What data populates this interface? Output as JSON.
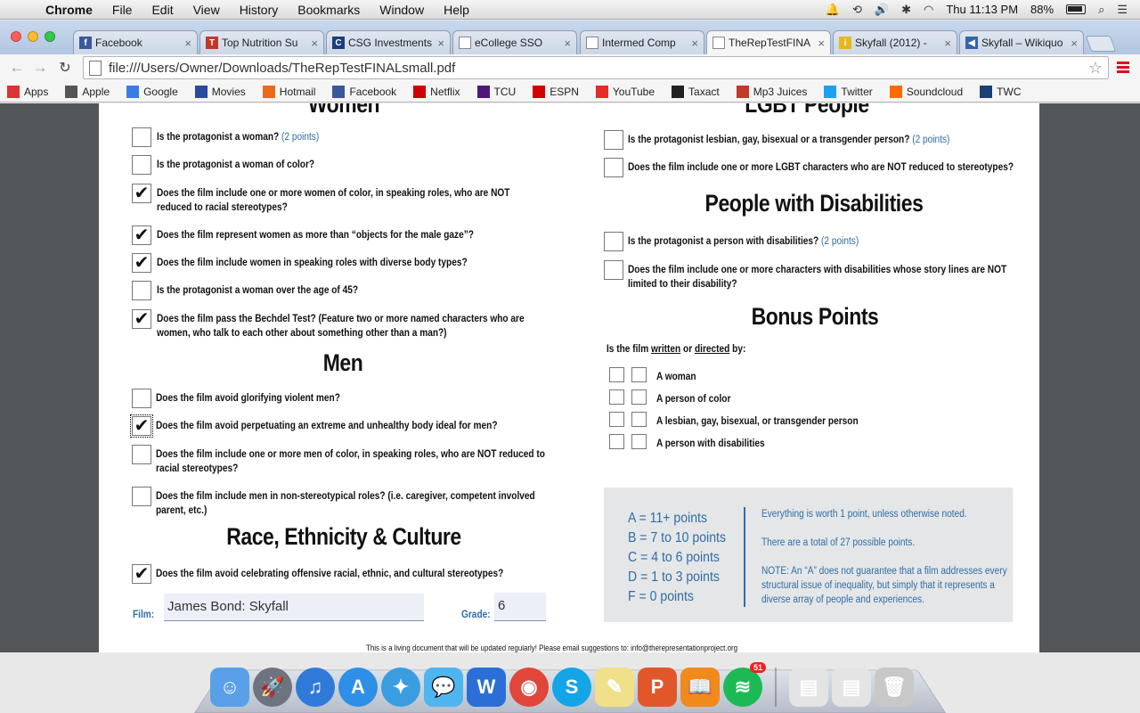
{
  "menubar": {
    "app": "Chrome",
    "items": [
      "File",
      "Edit",
      "View",
      "History",
      "Bookmarks",
      "Window",
      "Help"
    ],
    "clock": "Thu 11:13 PM",
    "battery": "88%"
  },
  "tabs": [
    {
      "label": "Facebook",
      "icon": "facebook-icon",
      "color": "#3b5998",
      "glyph": "f"
    },
    {
      "label": "Top Nutrition Su",
      "icon": "nutrition-icon",
      "color": "#c0392b",
      "glyph": "T"
    },
    {
      "label": "CSG Investments",
      "icon": "csg-icon",
      "color": "#1c3f7a",
      "glyph": "C"
    },
    {
      "label": "eCollege SSO",
      "icon": "document-icon",
      "color": "#ffffff",
      "glyph": ""
    },
    {
      "label": "Intermed Comp",
      "icon": "document-icon",
      "color": "#ffffff",
      "glyph": ""
    },
    {
      "label": "TheRepTestFINA",
      "icon": "document-icon",
      "color": "#ffffff",
      "glyph": ""
    },
    {
      "label": "Skyfall (2012) -",
      "icon": "imdb-icon",
      "color": "#e5b81d",
      "glyph": "i"
    },
    {
      "label": "Skyfall – Wikiquo",
      "icon": "speaker-icon",
      "color": "#3366aa",
      "glyph": "◀"
    }
  ],
  "address": "file:///Users/Owner/Downloads/TheRepTestFINALsmall.pdf",
  "bookmarks": [
    {
      "label": "Apps",
      "icon": "apps-grid-icon",
      "color": "#d33"
    },
    {
      "label": "Apple",
      "icon": "apple-icon",
      "color": "#555"
    },
    {
      "label": "Google",
      "icon": "google-icon",
      "color": "#3a7ce4"
    },
    {
      "label": "Movies",
      "icon": "movies-icon",
      "color": "#2a4aa0"
    },
    {
      "label": "Hotmail",
      "icon": "windows-icon",
      "color": "#e86a1c"
    },
    {
      "label": "Facebook",
      "icon": "facebook-icon",
      "color": "#3b5998"
    },
    {
      "label": "Netflix",
      "icon": "netflix-icon",
      "color": "#d10000"
    },
    {
      "label": "TCU",
      "icon": "tcu-icon",
      "color": "#4d1979"
    },
    {
      "label": "ESPN",
      "icon": "espn-icon",
      "color": "#d10000"
    },
    {
      "label": "YouTube",
      "icon": "youtube-icon",
      "color": "#e52d27"
    },
    {
      "label": "Taxact",
      "icon": "taxact-icon",
      "color": "#222222"
    },
    {
      "label": "Mp3 Juices",
      "icon": "mp3-icon",
      "color": "#c0392b"
    },
    {
      "label": "Twitter",
      "icon": "twitter-icon",
      "color": "#1da1f2"
    },
    {
      "label": "Soundcloud",
      "icon": "soundcloud-icon",
      "color": "#ff6a00"
    },
    {
      "label": "TWC",
      "icon": "twc-icon",
      "color": "#1c3f7a"
    }
  ],
  "doc": {
    "women_heading": "Women",
    "lgbt_heading": "LGBT People",
    "disabilities_heading": "People with Disabilities",
    "bonus_heading": "Bonus Points",
    "men_heading": "Men",
    "race_heading": "Race, Ethnicity & Culture",
    "women_questions": [
      {
        "text": "Is the protagonist a woman?",
        "points": "(2 points)",
        "checked": false
      },
      {
        "text": "Is the protagonist a woman of color?",
        "points": "",
        "checked": false
      },
      {
        "text": "Does the film include one or more women of color, in speaking roles, who are NOT reduced to racial stereotypes?",
        "points": "",
        "checked": true
      },
      {
        "text": "Does the film represent women as more than “objects for the male gaze”?",
        "points": "",
        "checked": true
      },
      {
        "text": "Does the film include women in speaking roles with diverse body types?",
        "points": "",
        "checked": true
      },
      {
        "text": "Is the protagonist a woman over the age of 45?",
        "points": "",
        "checked": false
      },
      {
        "text": "Does the film pass the Bechdel Test? (Feature two or more named characters who are women, who talk to each other about something other than a man?)",
        "points": "",
        "checked": true
      }
    ],
    "men_questions": [
      {
        "text": "Does the film avoid glorifying violent men?",
        "points": "",
        "checked": false
      },
      {
        "text": "Does the film avoid perpetuating an extreme and unhealthy body ideal for men?",
        "points": "",
        "checked": true
      },
      {
        "text": "Does the film include one or more men of color, in speaking roles, who are NOT reduced to racial stereotypes?",
        "points": "",
        "checked": false
      },
      {
        "text": "Does the film include men in non-stereotypical roles? (i.e. caregiver, competent involved parent, etc.)",
        "points": "",
        "checked": false
      }
    ],
    "race_questions": [
      {
        "text": "Does the film avoid celebrating offensive racial, ethnic, and cultural stereotypes?",
        "points": "",
        "checked": true
      }
    ],
    "lgbt_questions": [
      {
        "text": "Is the protagonist lesbian, gay, bisexual or a transgender person?",
        "points": "(2 points)",
        "checked": false
      },
      {
        "text": "Does the film include one or more LGBT characters who are NOT reduced to stereotypes?",
        "points": "",
        "checked": false
      }
    ],
    "disability_questions": [
      {
        "text": "Is the protagonist a person with disabilities?",
        "points": "(2 points)",
        "checked": false
      },
      {
        "text": "Does the film include one or more characters with disabilities whose story lines are NOT limited to their disability?",
        "points": "",
        "checked": false
      }
    ],
    "bonus_intro": {
      "pre": "Is the film ",
      "written": "written",
      "or": " or ",
      "directed": "directed",
      "post": " by:"
    },
    "bonus_items": [
      "A woman",
      "A person of color",
      "A lesbian, gay, bisexual, or transgender person",
      "A person with disabilities"
    ],
    "grades": [
      "A = 11+ points",
      "B = 7 to 10 points",
      "C = 4 to 6 points",
      "D = 1 to 3 points",
      "F = 0 points"
    ],
    "notes": [
      "Everything is worth 1 point, unless otherwise noted.",
      "There are a total of 27 possible points.",
      "NOTE: An “A” does not guarantee that a film addresses every structural issue of inequality, but simply that it represents a diverse array of people and experiences."
    ],
    "film_label": "Film:",
    "film_value": "James Bond: Skyfall",
    "grade_label": "Grade:",
    "grade_value": "6",
    "footer": "This is a living document that will be updated regularly! Please email suggestions to: info@therepresentationproject.org"
  },
  "dock": [
    {
      "name": "finder-icon",
      "color": "#5aa0e8",
      "glyph": "☺"
    },
    {
      "name": "launchpad-icon",
      "color": "#6d7480",
      "glyph": "🚀"
    },
    {
      "name": "itunes-icon",
      "color": "#2f7ad8",
      "glyph": "♫"
    },
    {
      "name": "app-store-icon",
      "color": "#2d8fe6",
      "glyph": "A"
    },
    {
      "name": "safari-icon",
      "color": "#3a9de0",
      "glyph": "✦"
    },
    {
      "name": "messages-icon",
      "color": "#4fb5f0",
      "glyph": "💬"
    },
    {
      "name": "word-icon",
      "color": "#2b6fd6",
      "glyph": "W"
    },
    {
      "name": "chrome-icon",
      "color": "#e0463a",
      "glyph": "◉"
    },
    {
      "name": "skype-icon",
      "color": "#12a5e8",
      "glyph": "S"
    },
    {
      "name": "stickies-icon",
      "color": "#f0e08a",
      "glyph": "✎"
    },
    {
      "name": "powerpoint-icon",
      "color": "#e2572a",
      "glyph": "P"
    },
    {
      "name": "ibooks-icon",
      "color": "#f08a1c",
      "glyph": "📖"
    },
    {
      "name": "spotify-icon",
      "color": "#1db954",
      "glyph": "≋",
      "badge": "51"
    },
    {
      "name": "separator",
      "color": "",
      "glyph": ""
    },
    {
      "name": "downloads-stack-icon",
      "color": "#e4e4e4",
      "glyph": "▤"
    },
    {
      "name": "documents-stack-icon",
      "color": "#e4e4e4",
      "glyph": "▤"
    },
    {
      "name": "trash-icon",
      "color": "#c8c8c8",
      "glyph": "🗑"
    }
  ]
}
